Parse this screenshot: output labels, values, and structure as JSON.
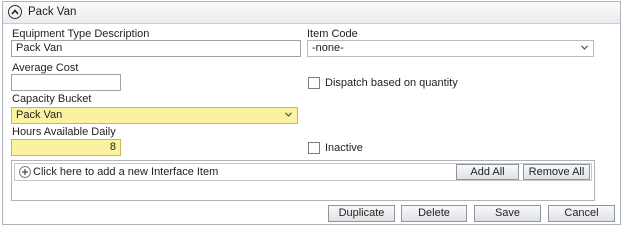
{
  "header": {
    "title": "Pack Van"
  },
  "form": {
    "equipment_type_description": {
      "label": "Equipment Type Description",
      "value": "Pack Van"
    },
    "item_code": {
      "label": "Item Code",
      "value": "-none-"
    },
    "average_cost": {
      "label": "Average Cost",
      "value": ""
    },
    "dispatch_based_on_quantity": {
      "label": "Dispatch based on quantity",
      "checked": false
    },
    "capacity_bucket": {
      "label": "Capacity Bucket",
      "value": "Pack Van"
    },
    "hours_available_daily": {
      "label": "Hours Available Daily",
      "value": "8"
    },
    "inactive": {
      "label": "Inactive",
      "checked": false
    }
  },
  "interface_items": {
    "add_prompt": "Click here to add a new Interface Item",
    "add_all_label": "Add All",
    "remove_all_label": "Remove All"
  },
  "footer": {
    "duplicate_label": "Duplicate",
    "delete_label": "Delete",
    "save_label": "Save",
    "cancel_label": "Cancel"
  },
  "colors": {
    "required_field_bg": "#fbf2a0",
    "border": "#aeb4ba"
  },
  "icons": {
    "collapse": "chevron-up-circle-icon",
    "dropdown": "chevron-down-icon",
    "add": "plus-circle-icon"
  }
}
